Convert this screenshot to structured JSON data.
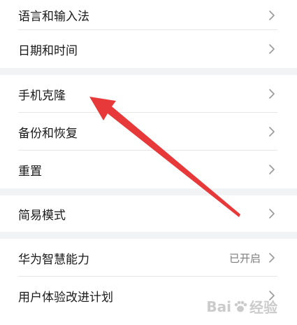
{
  "settings": {
    "group1": [
      {
        "label": "语言和输入法"
      },
      {
        "label": "日期和时间"
      }
    ],
    "group2": [
      {
        "label": "手机克隆"
      },
      {
        "label": "备份和恢复"
      },
      {
        "label": "重置"
      }
    ],
    "group3": [
      {
        "label": "简易模式"
      }
    ],
    "group4": [
      {
        "label": "华为智慧能力",
        "value": "已开启"
      },
      {
        "label": "用户体验改进计划"
      }
    ]
  },
  "annotation": {
    "arrow_color": "#e8393a"
  },
  "watermark": {
    "text": "Bai",
    "text2": "经验",
    "icon": "paw-icon"
  },
  "colors": {
    "section_gap": "#f1f3f5",
    "chevron": "#9a9a9a"
  }
}
